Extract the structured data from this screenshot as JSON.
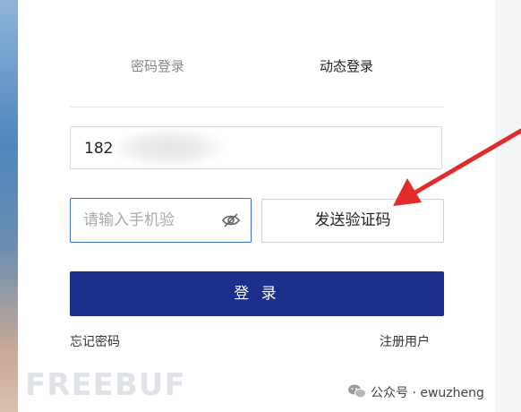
{
  "tabs": {
    "password_login": "密码登录",
    "dynamic_login": "动态登录"
  },
  "phone": {
    "value": "182"
  },
  "code": {
    "placeholder": "请输入手机验"
  },
  "send_code_label": "发送验证码",
  "login_label": "登 录",
  "forgot_password": "忘记密码",
  "register": "注册用户",
  "watermark": {
    "text": "FREEBUF"
  },
  "account": {
    "label": "公众号 · ewuzheng"
  },
  "icons": {
    "eye": "eye-slash-icon",
    "arrow": "arrow-annotation",
    "wechat": "wechat-icon"
  },
  "colors": {
    "primary": "#1c2f8a",
    "focus_border": "#3b6fd6",
    "arrow": "#e32b2b"
  }
}
